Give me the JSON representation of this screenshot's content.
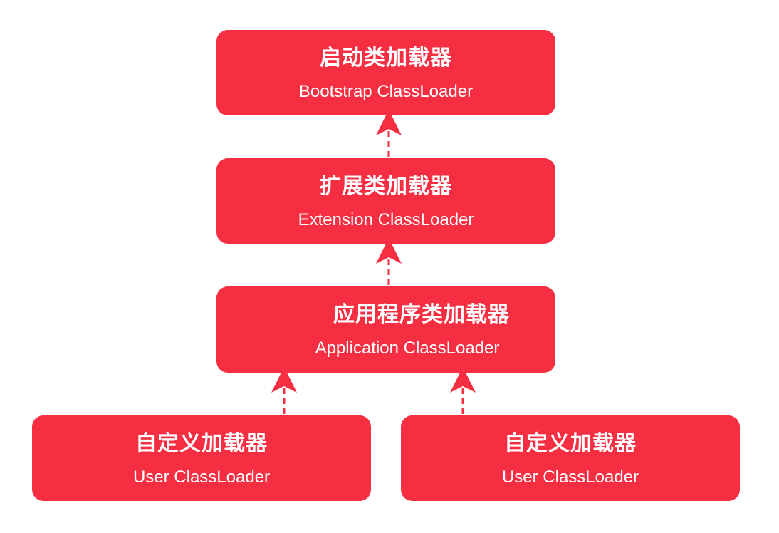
{
  "colors": {
    "node_fill": "#f52f41",
    "node_text": "#ffffff",
    "arrow": "#f52f41",
    "background": "#ffffff"
  },
  "nodes": {
    "bootstrap": {
      "title": "启动类加载器",
      "subtitle": "Bootstrap  ClassLoader"
    },
    "extension": {
      "title": "扩展类加载器",
      "subtitle": "Extension ClassLoader"
    },
    "application": {
      "title": "应用程序类加载器",
      "subtitle": "Application  ClassLoader"
    },
    "user_left": {
      "title": "自定义加载器",
      "subtitle": "User  ClassLoader"
    },
    "user_right": {
      "title": "自定义加载器",
      "subtitle": "User  ClassLoader"
    }
  },
  "edges": [
    {
      "from": "extension",
      "to": "bootstrap",
      "style": "dashed-arrow"
    },
    {
      "from": "application",
      "to": "extension",
      "style": "dashed-arrow"
    },
    {
      "from": "user_left",
      "to": "application",
      "style": "dashed-arrow"
    },
    {
      "from": "user_right",
      "to": "application",
      "style": "dashed-arrow"
    }
  ]
}
